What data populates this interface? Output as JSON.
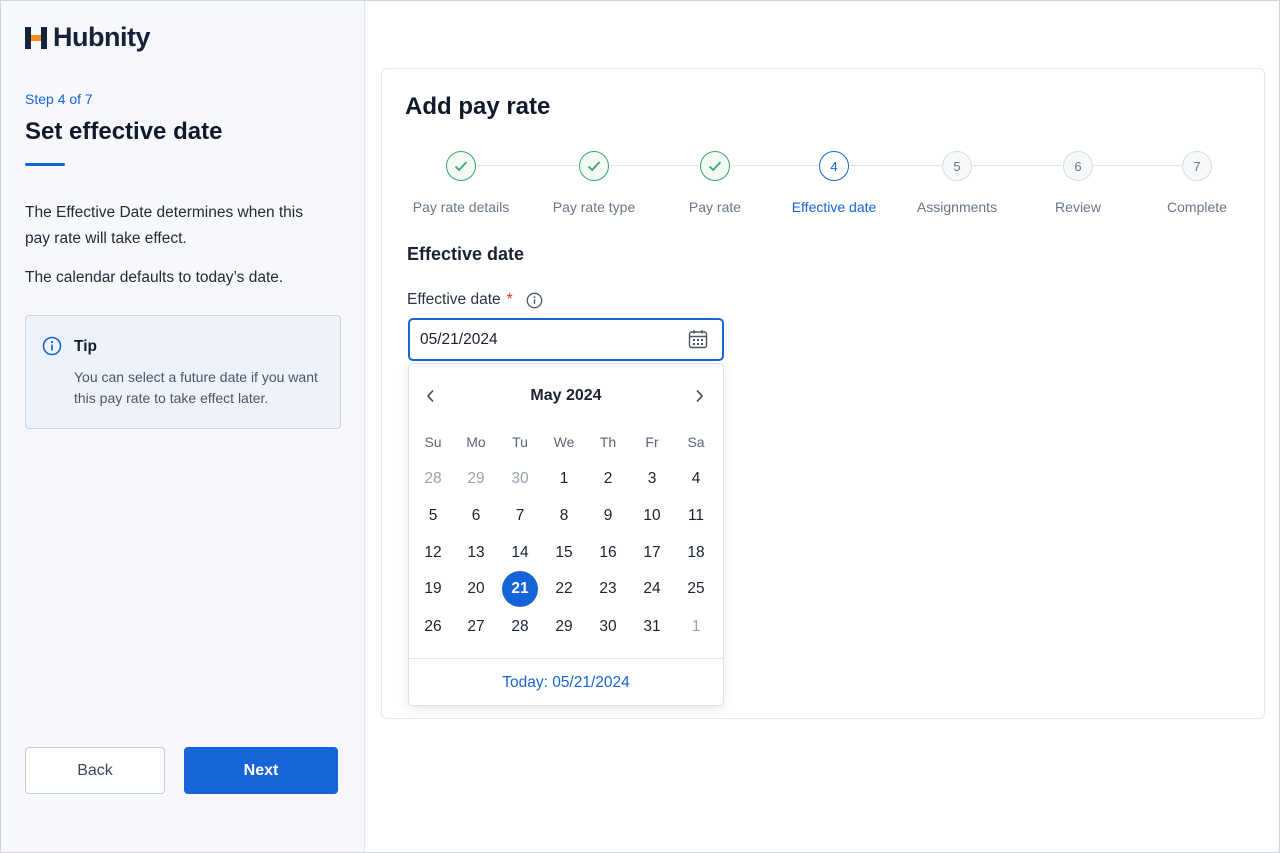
{
  "brand": {
    "name": "Hubnity",
    "accent": "#1565d8",
    "logo_orange": "#f28c1b"
  },
  "sidebar": {
    "step_label": "Step 4 of 7",
    "title": "Set effective date",
    "paragraph1": "The Effective Date determines when this pay rate will take effect.",
    "paragraph2": "The calendar defaults to today’s date.",
    "tip": {
      "icon": "info-icon",
      "title": "Tip",
      "body": "You can select a future date if you want this pay rate to take effect later."
    },
    "back_label": "Back",
    "next_label": "Next"
  },
  "main": {
    "title": "Add pay rate",
    "steps": [
      {
        "number": "1",
        "label": "Pay rate details",
        "state": "done"
      },
      {
        "number": "2",
        "label": "Pay rate type",
        "state": "done"
      },
      {
        "number": "3",
        "label": "Pay rate",
        "state": "done"
      },
      {
        "number": "4",
        "label": "Effective date",
        "state": "current"
      },
      {
        "number": "5",
        "label": "Assignments",
        "state": "upcoming"
      },
      {
        "number": "6",
        "label": "Review",
        "state": "upcoming"
      },
      {
        "number": "7",
        "label": "Complete",
        "state": "upcoming"
      }
    ],
    "section_title": "Effective date",
    "field_label": "Effective date",
    "required_mark": "*",
    "date_value": "05/21/2024",
    "calendar": {
      "month_label": "May 2024",
      "weekdays": [
        "Su",
        "Mo",
        "Tu",
        "We",
        "Th",
        "Fr",
        "Sa"
      ],
      "weeks": [
        [
          {
            "d": "28",
            "muted": true
          },
          {
            "d": "29",
            "muted": true
          },
          {
            "d": "30",
            "muted": true
          },
          {
            "d": "1"
          },
          {
            "d": "2"
          },
          {
            "d": "3"
          },
          {
            "d": "4"
          }
        ],
        [
          {
            "d": "5"
          },
          {
            "d": "6"
          },
          {
            "d": "7"
          },
          {
            "d": "8"
          },
          {
            "d": "9"
          },
          {
            "d": "10"
          },
          {
            "d": "11"
          }
        ],
        [
          {
            "d": "12"
          },
          {
            "d": "13"
          },
          {
            "d": "14"
          },
          {
            "d": "15"
          },
          {
            "d": "16"
          },
          {
            "d": "17"
          },
          {
            "d": "18"
          }
        ],
        [
          {
            "d": "19"
          },
          {
            "d": "20"
          },
          {
            "d": "21",
            "selected": true
          },
          {
            "d": "22"
          },
          {
            "d": "23"
          },
          {
            "d": "24"
          },
          {
            "d": "25"
          }
        ],
        [
          {
            "d": "26"
          },
          {
            "d": "27"
          },
          {
            "d": "28"
          },
          {
            "d": "29"
          },
          {
            "d": "30"
          },
          {
            "d": "31"
          },
          {
            "d": "1",
            "muted": true
          }
        ]
      ],
      "today_label": "Today: 05/21/2024"
    }
  }
}
